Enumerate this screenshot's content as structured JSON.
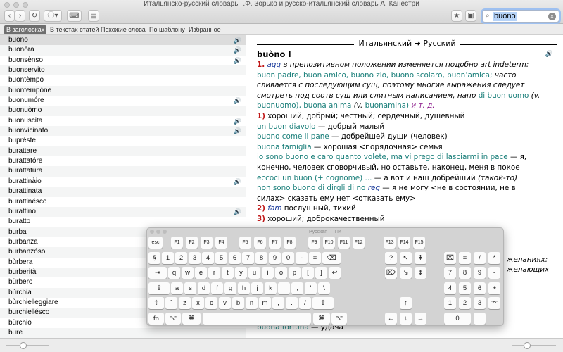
{
  "window": {
    "title": "Итальянско-русский словарь Г.Ф. Зорько и русско-итальянский словарь А. Канестри"
  },
  "toolbar": {
    "back": "‹",
    "forward": "›",
    "refresh": "↻",
    "info": "ⓘ▾",
    "keyboard": "⌨",
    "layout": "▤",
    "favorite": "★",
    "card": "▣"
  },
  "search": {
    "value": "buòno"
  },
  "search_tabs": [
    "В заголовках",
    "В текстах статей",
    "Похожие слова",
    "По шаблону",
    "Избранное"
  ],
  "words": [
    {
      "w": "buòno",
      "s": true,
      "sel": true
    },
    {
      "w": "buonóra",
      "s": true
    },
    {
      "w": "buonsènso",
      "s": true
    },
    {
      "w": "buonservito"
    },
    {
      "w": "buontèmpo"
    },
    {
      "w": "buontempóne"
    },
    {
      "w": "buonumóre",
      "s": true
    },
    {
      "w": "buonuòmo"
    },
    {
      "w": "buonuscita",
      "s": true
    },
    {
      "w": "buonvicinato",
      "s": true
    },
    {
      "w": "buprèste"
    },
    {
      "w": "burattare"
    },
    {
      "w": "burattatóre"
    },
    {
      "w": "burattatura"
    },
    {
      "w": "burattinàio",
      "s": true
    },
    {
      "w": "burattinata"
    },
    {
      "w": "burattinésco"
    },
    {
      "w": "burattino",
      "s": true
    },
    {
      "w": "buratto"
    },
    {
      "w": "burba"
    },
    {
      "w": "burbanza"
    },
    {
      "w": "burbanzóso"
    },
    {
      "w": "bùrbera"
    },
    {
      "w": "burberità"
    },
    {
      "w": "bùrbero"
    },
    {
      "w": "bùrchia"
    },
    {
      "w": "bùrchielleggiare"
    },
    {
      "w": "burchiellésco"
    },
    {
      "w": "bùrchio"
    },
    {
      "w": "bure"
    }
  ],
  "speaker_icon": "🔊",
  "article": {
    "direction": "Итальянский ➜ Русский",
    "headword": "buòno I",
    "l1_num": "1.",
    "l1_agg": "agg",
    "l1_rest": " в препозитивном положении изменяется подобно art indeterm:",
    "l2_it": "buon padre, buon amico, buono zio, buono scolaro, buon’amica;",
    "l2_rest": " часто",
    "l3": "сливается с последующим сущ, поэтому многие выражения следует",
    "l4_a": "смотреть под соотв сущ или слитным написанием, напр ",
    "l4_it": "di buon uomo",
    "l4_v": " (v.",
    "l5_it1": "buonuomo), buona anima",
    "l5_v": " (v.",
    "l5_it2": " buonamina)",
    "l5_tail": " и т. д.",
    "s1_num": "1)",
    "s1_ru": " хороший, добрый; честный; сердечный, душевный",
    "e1_it": "un buon diavolo",
    "e1_ru": " — добрый малый",
    "e2_it": "buono come il pane",
    "e2_ru": " — добрейшей души (человек)",
    "e3_it": "buona famiglia",
    "e3_ru": " — хорошая <порядочная> семья",
    "e4_it": "io sono buono e caro quanto volete, ma vi prego di lasciarmi in pace",
    "e4_ru": " — я,",
    "e5_ru": "конечно, человек сговорчивый, но оставьте, наконец, меня в покое",
    "e6_it": "eccoci un buon (+ cognome) ...",
    "e6_ru": " — а вот и наш добрейший ",
    "e6_i": "(такой-то)",
    "e7_it": "non sono buono di dirgli di no",
    "e7_reg": " reg",
    "e7_ru": " — я не могу <не в состоянии, не в",
    "e8_ru": "силах> сказать ему нет <отказать ему>",
    "s2_num": "2)",
    "s2_fam": " fam",
    "s2_ru": " послушный, тихий",
    "s3_num": "3)",
    "s3_ru": " хороший; доброкачественный",
    "frag1": "желаниях:",
    "frag2": "желающих",
    "e9_it": "buona fortuna",
    "e9_ru": " — удача"
  },
  "keyboard": {
    "title": "Русская — ПК",
    "row_fn": [
      "esc",
      "F1",
      "F2",
      "F3",
      "F4",
      "F5",
      "F6",
      "F7",
      "F8",
      "F9",
      "F10",
      "F11",
      "F12",
      "F13",
      "F14",
      "F15"
    ],
    "row_num": [
      "§",
      "1",
      "2",
      "3",
      "4",
      "5",
      "6",
      "7",
      "8",
      "9",
      "0",
      "-",
      "=",
      "⌫"
    ],
    "row_q": [
      "⇥",
      "q",
      "w",
      "e",
      "r",
      "t",
      "y",
      "u",
      "i",
      "o",
      "p",
      "[",
      "]",
      "↩"
    ],
    "row_a": [
      "⇪",
      "a",
      "s",
      "d",
      "f",
      "g",
      "h",
      "j",
      "k",
      "l",
      ";",
      "'",
      "\\"
    ],
    "row_z": [
      "⇧",
      "`",
      "z",
      "x",
      "c",
      "v",
      "b",
      "n",
      "m",
      ",",
      ".",
      "/",
      "⇧"
    ],
    "row_bottom": [
      "fn",
      "⌥",
      "⌘",
      "⌘",
      "⌥"
    ],
    "nav": [
      "?",
      "↖",
      "⇞",
      "⌦",
      "↘",
      "⇟"
    ],
    "arrows": [
      "↑",
      "←",
      "↓",
      "→"
    ],
    "numpad": [
      "⌧",
      "=",
      "/",
      "*",
      "7",
      "8",
      "9",
      "-",
      "4",
      "5",
      "6",
      "+",
      "1",
      "2",
      "3",
      "0",
      ".",
      "⌤"
    ]
  }
}
